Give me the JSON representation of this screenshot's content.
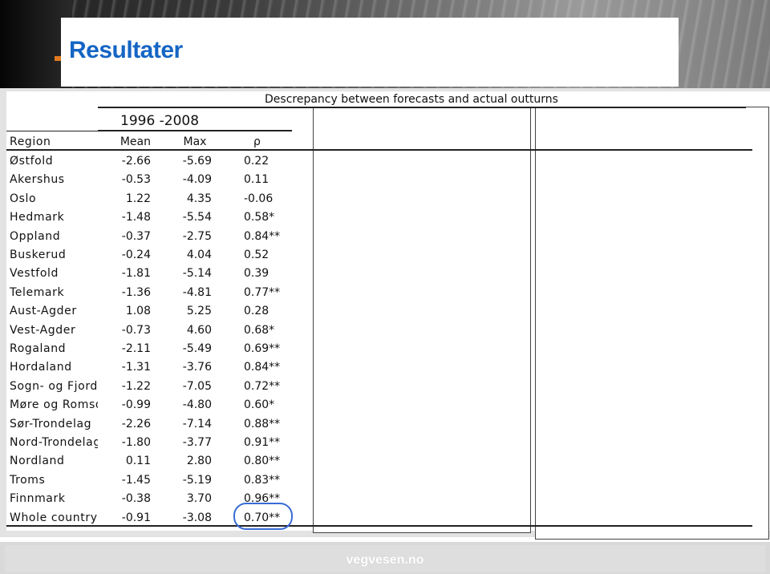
{
  "slide": {
    "title": "Resultater",
    "footer_logo": "vegvesen.no"
  },
  "table": {
    "caption": "Descrepancy between forecasts and actual outturns",
    "period": "1996 -2008",
    "headers": {
      "region": "Region",
      "mean": "Mean",
      "max": "Max",
      "rho": "ρ"
    },
    "rows": [
      {
        "region": "Østfold",
        "mean": "-2.66",
        "max": "-5.69",
        "rho": "0.22"
      },
      {
        "region": "Akershus",
        "mean": "-0.53",
        "max": "-4.09",
        "rho": "0.11"
      },
      {
        "region": "Oslo",
        "mean": "1.22",
        "max": "4.35",
        "rho": "-0.06"
      },
      {
        "region": "Hedmark",
        "mean": "-1.48",
        "max": "-5.54",
        "rho": "0.58*"
      },
      {
        "region": "Oppland",
        "mean": "-0.37",
        "max": "-2.75",
        "rho": "0.84**"
      },
      {
        "region": "Buskerud",
        "mean": "-0.24",
        "max": "4.04",
        "rho": "0.52"
      },
      {
        "region": "Vestfold",
        "mean": "-1.81",
        "max": "-5.14",
        "rho": "0.39"
      },
      {
        "region": "Telemark",
        "mean": "-1.36",
        "max": "-4.81",
        "rho": "0.77**"
      },
      {
        "region": "Aust-Agder",
        "mean": "1.08",
        "max": "5.25",
        "rho": "0.28"
      },
      {
        "region": "Vest-Agder",
        "mean": "-0.73",
        "max": "4.60",
        "rho": "0.68*"
      },
      {
        "region": "Rogaland",
        "mean": "-2.11",
        "max": "-5.49",
        "rho": "0.69**"
      },
      {
        "region": "Hordaland",
        "mean": "-1.31",
        "max": "-3.76",
        "rho": "0.84**"
      },
      {
        "region": "Sogn- og Fjordane",
        "mean": "-1.22",
        "max": "-7.05",
        "rho": "0.72**"
      },
      {
        "region": "Møre og Romsdal",
        "mean": "-0.99",
        "max": "-4.80",
        "rho": "0.60*"
      },
      {
        "region": "Sør-Trondelag",
        "mean": "-2.26",
        "max": "-7.14",
        "rho": "0.88**"
      },
      {
        "region": "Nord-Trondelag",
        "mean": "-1.80",
        "max": "-3.77",
        "rho": "0.91**"
      },
      {
        "region": "Nordland",
        "mean": "0.11",
        "max": "2.80",
        "rho": "0.80**"
      },
      {
        "region": "Troms",
        "mean": "-1.45",
        "max": "-5.19",
        "rho": "0.83**"
      },
      {
        "region": "Finnmark",
        "mean": "-0.38",
        "max": "3.70",
        "rho": "0.96**"
      },
      {
        "region": "Whole country",
        "mean": "-0.91",
        "max": "-3.08",
        "rho": "0.70**"
      }
    ]
  }
}
